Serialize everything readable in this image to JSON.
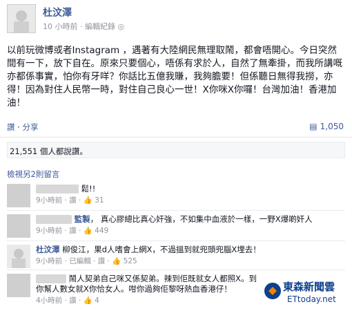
{
  "post": {
    "author": "杜汶澤",
    "meta": "10 小時前 · 編輯紀錄 ◎",
    "body": "以前玩微博或者Instagram ，遇著有大陸網民無理取鬧，都會唔開心。今日突然間有一下，放下自在。原來只要個心，唔係有求於人，自然了無牽掛，而我所講嘅亦都係事實，怕你有牙咩？你話比五億我賺，我夠膽要！但係聽日無得我撈，亦得！因為對住人民幣一時，對住自己良心一世！X你咪X你囉！台灣加油！香港加油！",
    "actions": [
      "讚",
      "分享"
    ],
    "share_count": "1,050",
    "likes_text": "21,551 個人都說讚。",
    "view_more": "檢視另2則留言"
  },
  "comments": [
    {
      "author": "",
      "text": "鬆!!",
      "meta": "9小時前 · 讚 ·",
      "likes": "31"
    },
    {
      "author": "監製",
      "text": "真心膠總比真心奸強，不如集中血液於一樣，一野X爆啲奸人",
      "meta": "9小時前 · 讚 ·",
      "likes": "449"
    },
    {
      "author": "杜汶澤",
      "text": "柳俊江，果d人嗜會上網X，不過搵到就兜頭兜腦X埋去！",
      "meta": "9小時前 · 已編輯 · 讚 ·",
      "likes": "525"
    },
    {
      "author": "",
      "text": "鬧人契弟自己咪又係契弟。辣到佢既就女人都照X。到你幫人數女就X你恰女人。咁你過夠佢黎呀熱血香港仔！",
      "meta": "4小時前 · 讚 ·",
      "likes": "4"
    }
  ],
  "logo": {
    "main": "東森新聞雲",
    "sub": "ETtoday.net"
  }
}
